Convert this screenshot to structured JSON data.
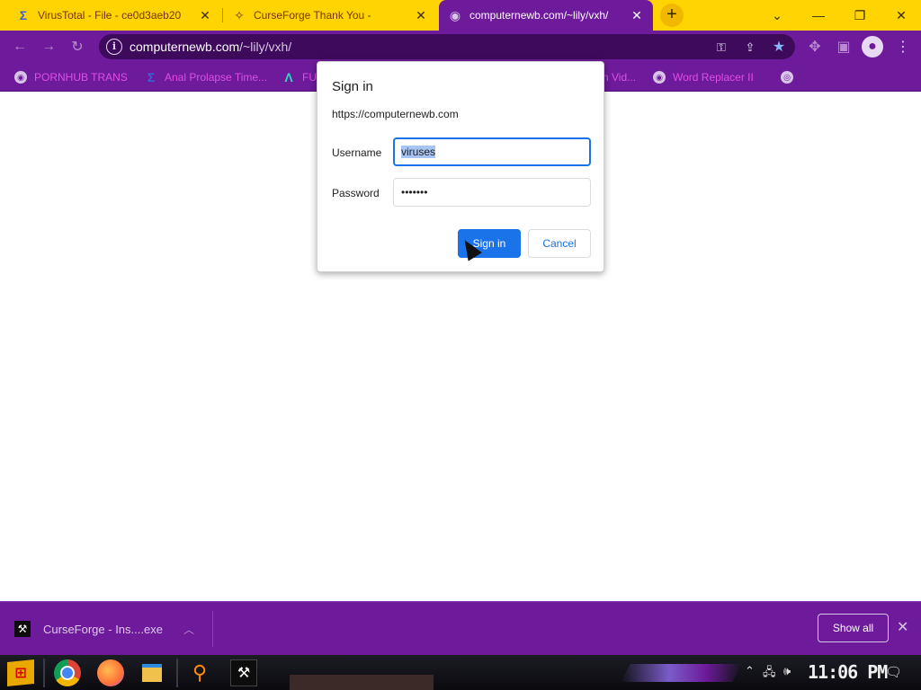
{
  "tabs": [
    {
      "title": "VirusTotal - File - ce0d3aeb20",
      "icon": "virustotal-icon"
    },
    {
      "title": "CurseForge Thank You -",
      "icon": "curseforge-icon"
    },
    {
      "title": "computernewb.com/~lily/vxh/",
      "icon": "globe-icon",
      "active": true
    }
  ],
  "omnibox": {
    "host": "computernewb.com",
    "path": "/~lily/vxh/"
  },
  "bookmarks": [
    {
      "label": "PORNHUB TRANS",
      "icon": "globe-icon"
    },
    {
      "label": "Anal Prolapse Time...",
      "icon": "virustotal-icon"
    },
    {
      "label": "FU",
      "icon": "lambda-icon"
    },
    {
      "label": "n Vid...",
      "icon": "none"
    },
    {
      "label": "Word Replacer II",
      "icon": "globe-icon"
    }
  ],
  "dialog": {
    "title": "Sign in",
    "origin": "https://computernewb.com",
    "username_label": "Username",
    "username_value": "viruses",
    "password_label": "Password",
    "password_value": "•••••••",
    "signin_label": "Sign in",
    "cancel_label": "Cancel"
  },
  "download_bar": {
    "filename": "CurseForge - Ins....exe",
    "show_all": "Show all"
  },
  "taskbar": {
    "clock": "11:06 PM"
  },
  "colors": {
    "theme": "#6d1b9a",
    "tabstrip": "#ffd400",
    "accent": "#1a73e8"
  }
}
